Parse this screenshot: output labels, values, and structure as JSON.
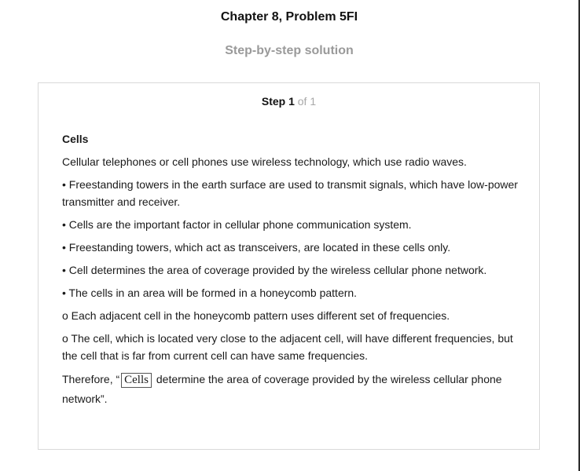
{
  "header": {
    "title": "Chapter 8, Problem 5FI",
    "subtitle": "Step-by-step solution"
  },
  "step": {
    "label": "Step 1",
    "of_text": "of 1"
  },
  "solution": {
    "heading": "Cells",
    "paragraphs": [
      "Cellular telephones or cell phones use wireless technology, which use radio waves.",
      "• Freestanding towers in the earth surface are used to transmit signals, which have low-power transmitter and receiver.",
      "• Cells are the important factor in cellular phone communication system.",
      "• Freestanding towers, which act as transceivers, are located in these cells only.",
      "• Cell determines the area of coverage provided by the wireless cellular phone network.",
      "• The cells in an area will be formed in a honeycomb pattern.",
      "o Each adjacent cell in the honeycomb pattern uses different set of frequencies.",
      "o The cell, which is located very close to the adjacent cell, will have different frequencies, but the cell that is far from current cell can have same frequencies."
    ],
    "conclusion_prefix": "Therefore, “",
    "answer": "Cells",
    "conclusion_suffix": " determine the area of coverage provided by the wireless cellular phone network”."
  }
}
